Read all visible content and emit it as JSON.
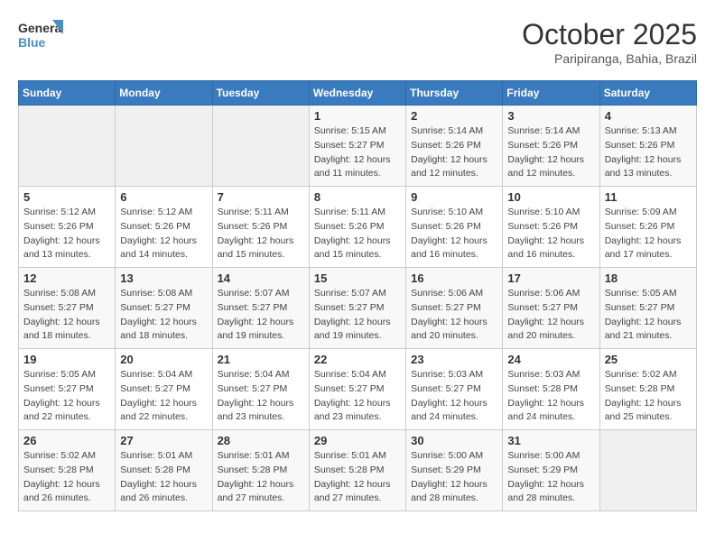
{
  "header": {
    "logo_line1": "General",
    "logo_line2": "Blue",
    "month": "October 2025",
    "location": "Paripiranga, Bahia, Brazil"
  },
  "weekdays": [
    "Sunday",
    "Monday",
    "Tuesday",
    "Wednesday",
    "Thursday",
    "Friday",
    "Saturday"
  ],
  "weeks": [
    [
      {
        "day": "",
        "info": ""
      },
      {
        "day": "",
        "info": ""
      },
      {
        "day": "",
        "info": ""
      },
      {
        "day": "1",
        "info": "Sunrise: 5:15 AM\nSunset: 5:27 PM\nDaylight: 12 hours\nand 11 minutes."
      },
      {
        "day": "2",
        "info": "Sunrise: 5:14 AM\nSunset: 5:26 PM\nDaylight: 12 hours\nand 12 minutes."
      },
      {
        "day": "3",
        "info": "Sunrise: 5:14 AM\nSunset: 5:26 PM\nDaylight: 12 hours\nand 12 minutes."
      },
      {
        "day": "4",
        "info": "Sunrise: 5:13 AM\nSunset: 5:26 PM\nDaylight: 12 hours\nand 13 minutes."
      }
    ],
    [
      {
        "day": "5",
        "info": "Sunrise: 5:12 AM\nSunset: 5:26 PM\nDaylight: 12 hours\nand 13 minutes."
      },
      {
        "day": "6",
        "info": "Sunrise: 5:12 AM\nSunset: 5:26 PM\nDaylight: 12 hours\nand 14 minutes."
      },
      {
        "day": "7",
        "info": "Sunrise: 5:11 AM\nSunset: 5:26 PM\nDaylight: 12 hours\nand 15 minutes."
      },
      {
        "day": "8",
        "info": "Sunrise: 5:11 AM\nSunset: 5:26 PM\nDaylight: 12 hours\nand 15 minutes."
      },
      {
        "day": "9",
        "info": "Sunrise: 5:10 AM\nSunset: 5:26 PM\nDaylight: 12 hours\nand 16 minutes."
      },
      {
        "day": "10",
        "info": "Sunrise: 5:10 AM\nSunset: 5:26 PM\nDaylight: 12 hours\nand 16 minutes."
      },
      {
        "day": "11",
        "info": "Sunrise: 5:09 AM\nSunset: 5:26 PM\nDaylight: 12 hours\nand 17 minutes."
      }
    ],
    [
      {
        "day": "12",
        "info": "Sunrise: 5:08 AM\nSunset: 5:27 PM\nDaylight: 12 hours\nand 18 minutes."
      },
      {
        "day": "13",
        "info": "Sunrise: 5:08 AM\nSunset: 5:27 PM\nDaylight: 12 hours\nand 18 minutes."
      },
      {
        "day": "14",
        "info": "Sunrise: 5:07 AM\nSunset: 5:27 PM\nDaylight: 12 hours\nand 19 minutes."
      },
      {
        "day": "15",
        "info": "Sunrise: 5:07 AM\nSunset: 5:27 PM\nDaylight: 12 hours\nand 19 minutes."
      },
      {
        "day": "16",
        "info": "Sunrise: 5:06 AM\nSunset: 5:27 PM\nDaylight: 12 hours\nand 20 minutes."
      },
      {
        "day": "17",
        "info": "Sunrise: 5:06 AM\nSunset: 5:27 PM\nDaylight: 12 hours\nand 20 minutes."
      },
      {
        "day": "18",
        "info": "Sunrise: 5:05 AM\nSunset: 5:27 PM\nDaylight: 12 hours\nand 21 minutes."
      }
    ],
    [
      {
        "day": "19",
        "info": "Sunrise: 5:05 AM\nSunset: 5:27 PM\nDaylight: 12 hours\nand 22 minutes."
      },
      {
        "day": "20",
        "info": "Sunrise: 5:04 AM\nSunset: 5:27 PM\nDaylight: 12 hours\nand 22 minutes."
      },
      {
        "day": "21",
        "info": "Sunrise: 5:04 AM\nSunset: 5:27 PM\nDaylight: 12 hours\nand 23 minutes."
      },
      {
        "day": "22",
        "info": "Sunrise: 5:04 AM\nSunset: 5:27 PM\nDaylight: 12 hours\nand 23 minutes."
      },
      {
        "day": "23",
        "info": "Sunrise: 5:03 AM\nSunset: 5:27 PM\nDaylight: 12 hours\nand 24 minutes."
      },
      {
        "day": "24",
        "info": "Sunrise: 5:03 AM\nSunset: 5:28 PM\nDaylight: 12 hours\nand 24 minutes."
      },
      {
        "day": "25",
        "info": "Sunrise: 5:02 AM\nSunset: 5:28 PM\nDaylight: 12 hours\nand 25 minutes."
      }
    ],
    [
      {
        "day": "26",
        "info": "Sunrise: 5:02 AM\nSunset: 5:28 PM\nDaylight: 12 hours\nand 26 minutes."
      },
      {
        "day": "27",
        "info": "Sunrise: 5:01 AM\nSunset: 5:28 PM\nDaylight: 12 hours\nand 26 minutes."
      },
      {
        "day": "28",
        "info": "Sunrise: 5:01 AM\nSunset: 5:28 PM\nDaylight: 12 hours\nand 27 minutes."
      },
      {
        "day": "29",
        "info": "Sunrise: 5:01 AM\nSunset: 5:28 PM\nDaylight: 12 hours\nand 27 minutes."
      },
      {
        "day": "30",
        "info": "Sunrise: 5:00 AM\nSunset: 5:29 PM\nDaylight: 12 hours\nand 28 minutes."
      },
      {
        "day": "31",
        "info": "Sunrise: 5:00 AM\nSunset: 5:29 PM\nDaylight: 12 hours\nand 28 minutes."
      },
      {
        "day": "",
        "info": ""
      }
    ]
  ]
}
